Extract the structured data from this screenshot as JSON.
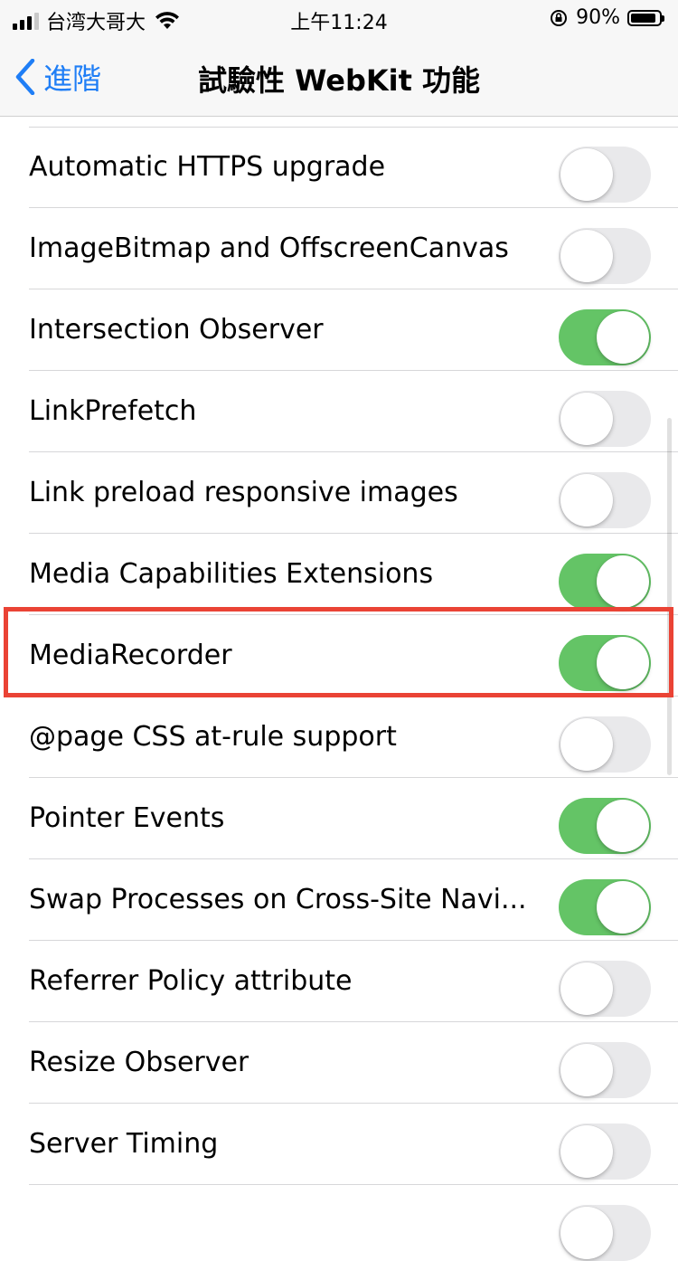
{
  "status_bar": {
    "carrier": "台湾大哥大",
    "time": "上午11:24",
    "battery": "90%",
    "icons": [
      "signal-icon",
      "wifi-icon",
      "orientation-lock-icon",
      "battery-icon"
    ]
  },
  "nav": {
    "back_label": "進階",
    "title": "試驗性 WebKit 功能"
  },
  "colors": {
    "accent": "#1f7ef6",
    "toggle_on": "#64c466",
    "toggle_off": "#e9e9eb",
    "highlight": "#ea4335"
  },
  "rows": [
    {
      "label": "Automatic HTTPS upgrade",
      "on": false
    },
    {
      "label": "ImageBitmap and OffscreenCanvas",
      "on": false
    },
    {
      "label": "Intersection Observer",
      "on": true
    },
    {
      "label": "LinkPrefetch",
      "on": false
    },
    {
      "label": "Link preload responsive images",
      "on": false
    },
    {
      "label": "Media Capabilities Extensions",
      "on": true
    },
    {
      "label": "MediaRecorder",
      "on": true
    },
    {
      "label": "@page CSS at-rule support",
      "on": false
    },
    {
      "label": "Pointer Events",
      "on": true
    },
    {
      "label": "Swap Processes on Cross-Site Navi...",
      "on": true
    },
    {
      "label": "Referrer Policy attribute",
      "on": false
    },
    {
      "label": "Resize Observer",
      "on": false
    },
    {
      "label": "Server Timing",
      "on": false
    }
  ]
}
